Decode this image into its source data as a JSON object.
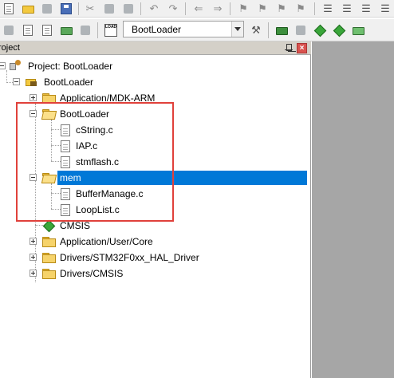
{
  "panel": {
    "title": "roject"
  },
  "toolbar": {
    "target_name": "BootLoader",
    "load_label": "LOAD"
  },
  "tree": {
    "project_label": "Project: BootLoader",
    "target_label": "BootLoader",
    "groups": [
      {
        "label": "Application/MDK-ARM",
        "expanded": false
      },
      {
        "label": "BootLoader",
        "expanded": true,
        "files": [
          "cString.c",
          "IAP.c",
          "stmflash.c"
        ]
      },
      {
        "label": "mem",
        "expanded": true,
        "selected": true,
        "files": [
          "BufferManage.c",
          "LoopList.c"
        ]
      },
      {
        "label": "CMSIS",
        "kind": "component"
      },
      {
        "label": "Application/User/Core",
        "expanded": false
      },
      {
        "label": "Drivers/STM32F0xx_HAL_Driver",
        "expanded": false
      },
      {
        "label": "Drivers/CMSIS",
        "expanded": false
      }
    ]
  },
  "colors": {
    "selection": "#0078d7",
    "highlight_box": "#e0413b",
    "editor_background": "#a6a6a6"
  },
  "icons": [
    "new-file-icon",
    "open-folder-icon",
    "save-icon",
    "save-all-icon",
    "cut-icon",
    "copy-icon",
    "paste-icon",
    "undo-icon",
    "redo-icon",
    "back-icon",
    "forward-icon",
    "bookmark-icon",
    "indent-icon",
    "outdent-icon",
    "comment-icon",
    "translate-icon",
    "build-icon",
    "rebuild-icon",
    "batch-build-icon",
    "download-icon",
    "options-icon",
    "manage-components-icon",
    "pin-icon",
    "close-icon"
  ]
}
